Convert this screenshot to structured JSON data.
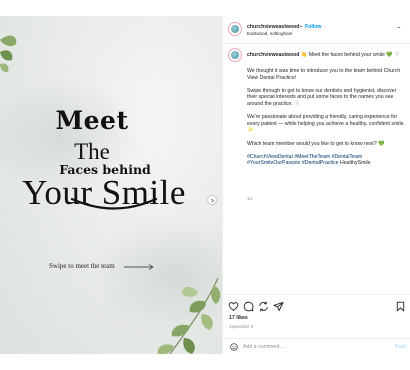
{
  "media": {
    "headline_meet": "Meet",
    "headline_the": "The",
    "headline_faces": "Faces behind",
    "headline_smile": "Your Smile",
    "swipe_hint": "Swipe to meet the team"
  },
  "header": {
    "username": "churchvieweastwood",
    "separator": "•",
    "follow_label": "Follow",
    "location": "Eastwood, nottingham",
    "more_label": "..."
  },
  "caption": {
    "username": "churchvieweastwood",
    "headline": "👋 Meet the faces behind your smile 💚 🦷",
    "paragraphs": [
      "We thought it was time to introduce you to the team behind Church View Dental Practice!",
      "Swipe through to get to know our dentists and hygienist, discover their special interests and put some faces to the names you see around the practice. 🦷",
      "We're passionate about providing a friendly, caring experience for every patient — while helping you achieve a healthy, confident smile. ✨",
      "Which team member would you like to get to know next? 💚"
    ],
    "hashtags": "#ChurchViewDental #MeetTheTeam #DentalTeam #YourSmileOurPassion #DentalPractice",
    "hashtag_trailing": "HealthySmile",
    "age": "1w"
  },
  "actions": {
    "likes": "17 likes",
    "date": "September 8"
  },
  "comment": {
    "placeholder": "Add a comment...",
    "post_label": "Post"
  },
  "icons": [
    "heart-icon",
    "comment-icon",
    "share-icon",
    "send-icon",
    "bookmark-icon",
    "emoji-icon",
    "chevron-right-icon",
    "arrow-right-icon",
    "leaf-icon"
  ],
  "colors": {
    "link": "#0095f6",
    "hashtag": "#00376b",
    "muted": "#8e8e8e",
    "post_disabled": "#b2dffc"
  }
}
